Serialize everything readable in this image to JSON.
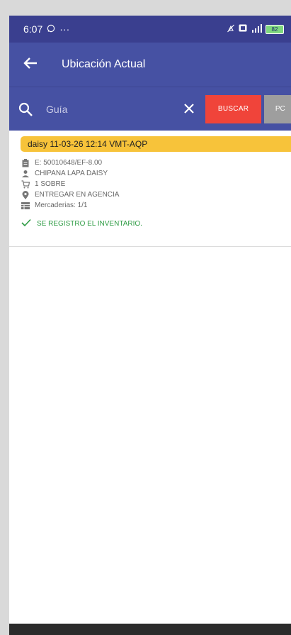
{
  "statusbar": {
    "time": "6:07",
    "extra": "···",
    "battery": "82"
  },
  "appbar": {
    "title": "Ubicación Actual"
  },
  "search": {
    "placeholder": "Guía",
    "buscar_label": "BUSCAR",
    "extra_label": "PC"
  },
  "item": {
    "header": "daisy  11-03-26 12:14 VMT-AQP",
    "code": "E: 50010648/EF-8.00",
    "person": "CHIPANA LAPA DAISY",
    "package": "1 SOBRE",
    "delivery": "ENTREGAR EN AGENCIA",
    "goods": "Mercaderias: 1/1",
    "status": "SE REGISTRO EL INVENTARIO."
  },
  "colors": {
    "statusbar": "#3a3f8f",
    "appbar": "#4651a3",
    "header_badge": "#f7c33a",
    "buscar": "#f0443a",
    "success": "#2e9b44"
  },
  "icons": {
    "back": "arrow-left-icon",
    "search": "search-icon",
    "clear": "close-icon",
    "code": "clipboard-icon",
    "person": "person-icon",
    "package": "cart-icon",
    "delivery": "location-pin-icon",
    "goods": "table-icon",
    "status": "check-icon"
  }
}
